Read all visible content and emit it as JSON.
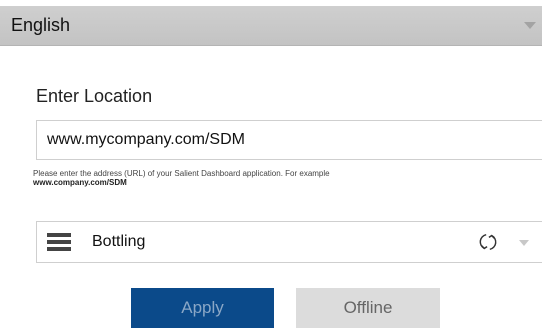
{
  "language": {
    "label": "English"
  },
  "location": {
    "title": "Enter Location",
    "url_value": "www.mycompany.com/SDM",
    "help_text": "Please enter the address (URL) of your Salient Dashboard application. For example",
    "help_example": "www.company.com/SDM"
  },
  "dashboard": {
    "icon": "list-icon",
    "selected": "Bottling",
    "refresh_icon": "refresh-icon"
  },
  "actions": {
    "apply_label": "Apply",
    "offline_label": "Offline"
  },
  "colors": {
    "apply_bg": "#0b4a8a",
    "offline_bg": "#dcdcdc",
    "language_bar_bg": "#c9c9c9"
  }
}
